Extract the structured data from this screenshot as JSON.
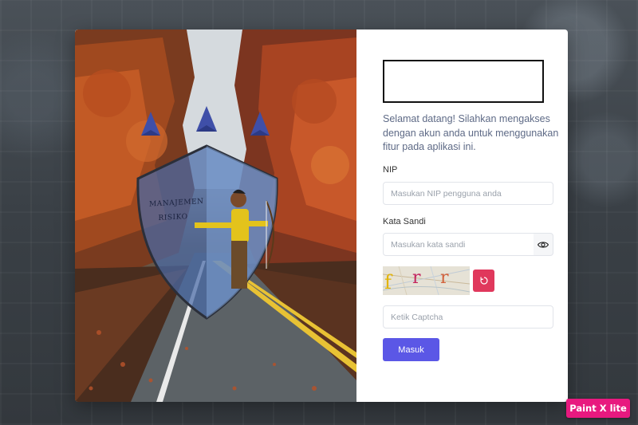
{
  "art": {
    "shield_text_line1": "MANAJEMEN",
    "shield_text_line2": "RISIKO"
  },
  "form": {
    "welcome_text": "Selamat datang! Silahkan mengakses dengan akun anda untuk menggunakan fitur pada aplikasi ini.",
    "nip_label": "NIP",
    "nip_placeholder": "Masukan NIP pengguna anda",
    "password_label": "Kata Sandi",
    "password_placeholder": "Masukan kata sandi",
    "captcha_chars": [
      "f",
      "r",
      "r"
    ],
    "captcha_placeholder": "Ketik Captcha",
    "submit_label": "Masuk"
  },
  "overlay": {
    "watermark_badge": "Paint X lite"
  },
  "colors": {
    "primary": "#5b57e6",
    "refresh": "#e0385c",
    "badge": "#e8197f"
  }
}
